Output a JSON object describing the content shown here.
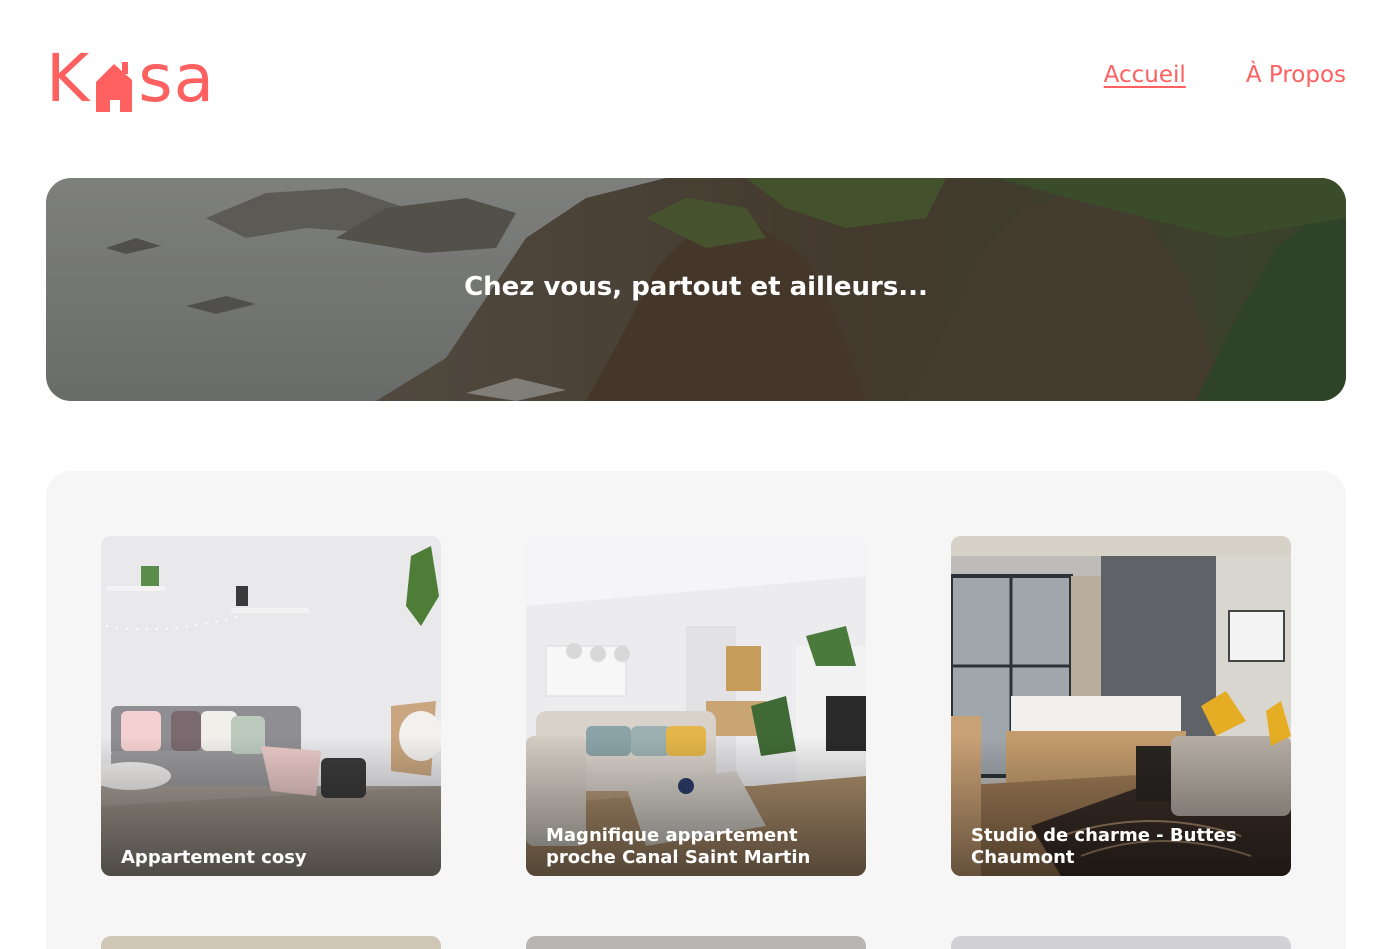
{
  "brand": {
    "logo_left": "K",
    "logo_right": "sa",
    "accent_color": "#ff6060"
  },
  "nav": {
    "items": [
      {
        "label": "Accueil",
        "active": true
      },
      {
        "label": "À Propos",
        "active": false
      }
    ]
  },
  "banner": {
    "title": "Chez vous, partout et ailleurs..."
  },
  "gallery": {
    "cards": [
      {
        "title": "Appartement cosy"
      },
      {
        "title": "Magnifique appartement proche Canal Saint Martin"
      },
      {
        "title": "Studio de charme - Buttes Chaumont"
      }
    ]
  }
}
